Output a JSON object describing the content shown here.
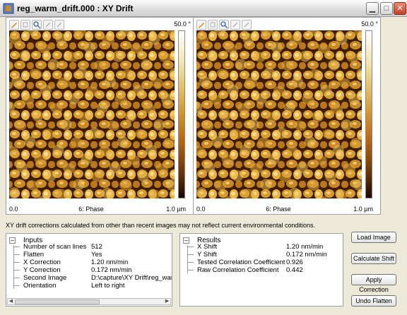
{
  "window": {
    "title": "reg_warm_drift.000 : XY Drift"
  },
  "left_image": {
    "scale_max": "50.0 °",
    "x_start": "0.0",
    "channel": "6: Phase",
    "x_end": "1.0 µm"
  },
  "right_image": {
    "scale_max": "50.0 °",
    "x_start": "0.0",
    "channel": "6: Phase",
    "x_end": "1.0 µm"
  },
  "notice": "XY drift corrections calculated from other than recent images may not reflect current environmental conditions.",
  "inputs": {
    "title": "Inputs",
    "rows": [
      {
        "name": "Number of scan lines",
        "value": "512"
      },
      {
        "name": "Flatten",
        "value": "Yes"
      },
      {
        "name": "X Correction",
        "value": "1.20 nm/min"
      },
      {
        "name": "Y Correction",
        "value": "0.172 nm/min"
      },
      {
        "name": "Second Image",
        "value": "D:\\capture\\XY Drift\\reg_warm"
      },
      {
        "name": "Orientation",
        "value": "Left to right"
      }
    ]
  },
  "results": {
    "title": "Results",
    "rows": [
      {
        "name": "X Shift",
        "value": "1.20 nm/min"
      },
      {
        "name": "Y Shift",
        "value": "0.172 nm/min"
      },
      {
        "name": "Tested Correlation Coefficient",
        "value": "0.926"
      },
      {
        "name": "Raw Correlation Coefficient",
        "value": "0.442"
      }
    ]
  },
  "buttons": {
    "load": "Load Image",
    "calculate": "Calculate Shift",
    "apply": "Apply Correction",
    "undo": "Undo Flatten"
  },
  "colors": {
    "grain_light": "#e9b341",
    "grain_dark": "#3a1a03",
    "window_bg": "#ece9d8"
  }
}
